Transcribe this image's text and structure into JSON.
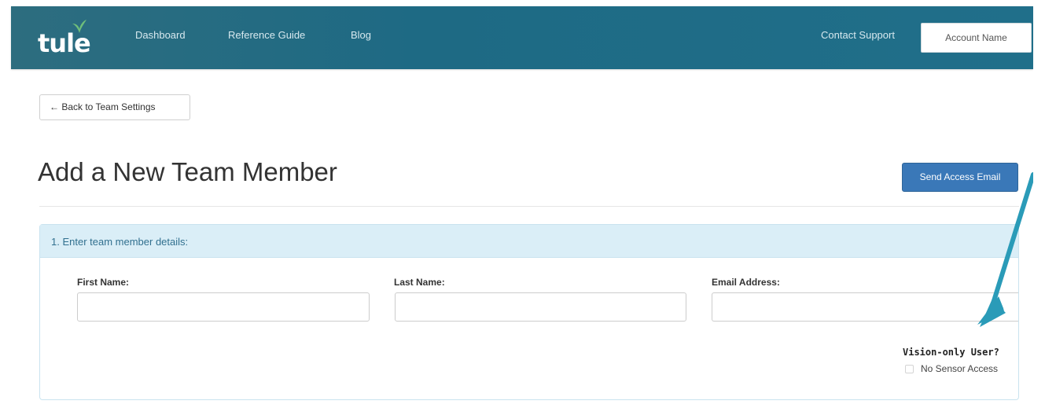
{
  "brand": {
    "logo_text": "tule",
    "accent_color": "#206f8a",
    "button_color": "#3a78b8",
    "panel_heading_color": "#daeef7",
    "annotation_arrow_color": "#2a9bb8"
  },
  "navbar": {
    "links": [
      "Dashboard",
      "Reference Guide",
      "Blog"
    ],
    "contact": "Contact Support",
    "account": "Account Name"
  },
  "back_button": {
    "label": "← Back to Team Settings"
  },
  "page": {
    "title": "Add a New Team Member",
    "send_button": "Send Access Email"
  },
  "panel": {
    "heading": "1. Enter team member details:",
    "fields": [
      {
        "label": "First Name:",
        "value": ""
      },
      {
        "label": "Last Name:",
        "value": ""
      },
      {
        "label": "Email Address:",
        "value": ""
      }
    ],
    "vision_label": "Vision-only User?",
    "sensor_checkbox_label": "No Sensor Access",
    "sensor_checked": false
  },
  "icons": [
    "leaf-icon",
    "arrow-annotation-icon",
    "checkbox-icon"
  ]
}
